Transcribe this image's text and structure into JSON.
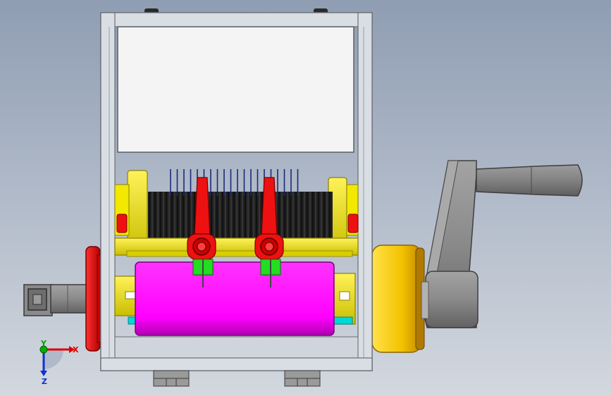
{
  "viewport": {
    "background_top": "#8f9db3",
    "background_bottom": "#d3d8df"
  },
  "colors": {
    "frame": "#d9dde4",
    "frame_edge": "#6a6e75",
    "yellow": "#f2e800",
    "yellow_dark": "#bdb300",
    "red": "#ee1111",
    "red_dark": "#8a0000",
    "magenta": "#ff00ff",
    "magenta_dark": "#c000c0",
    "green": "#22dd22",
    "gold": "#f4c800",
    "gold_dark": "#c08a00",
    "gray": "#8a8a8a",
    "gray_dark": "#555555",
    "blade_dark": "#1a1a1a",
    "blade_blue": "#1a2a7a",
    "cyan": "#00d8d8"
  },
  "triad": {
    "x_label": "X",
    "y_label": "Y",
    "z_label": "Z",
    "x_color": "#e00000",
    "y_color": "#00b000",
    "z_color": "#1030d0"
  }
}
